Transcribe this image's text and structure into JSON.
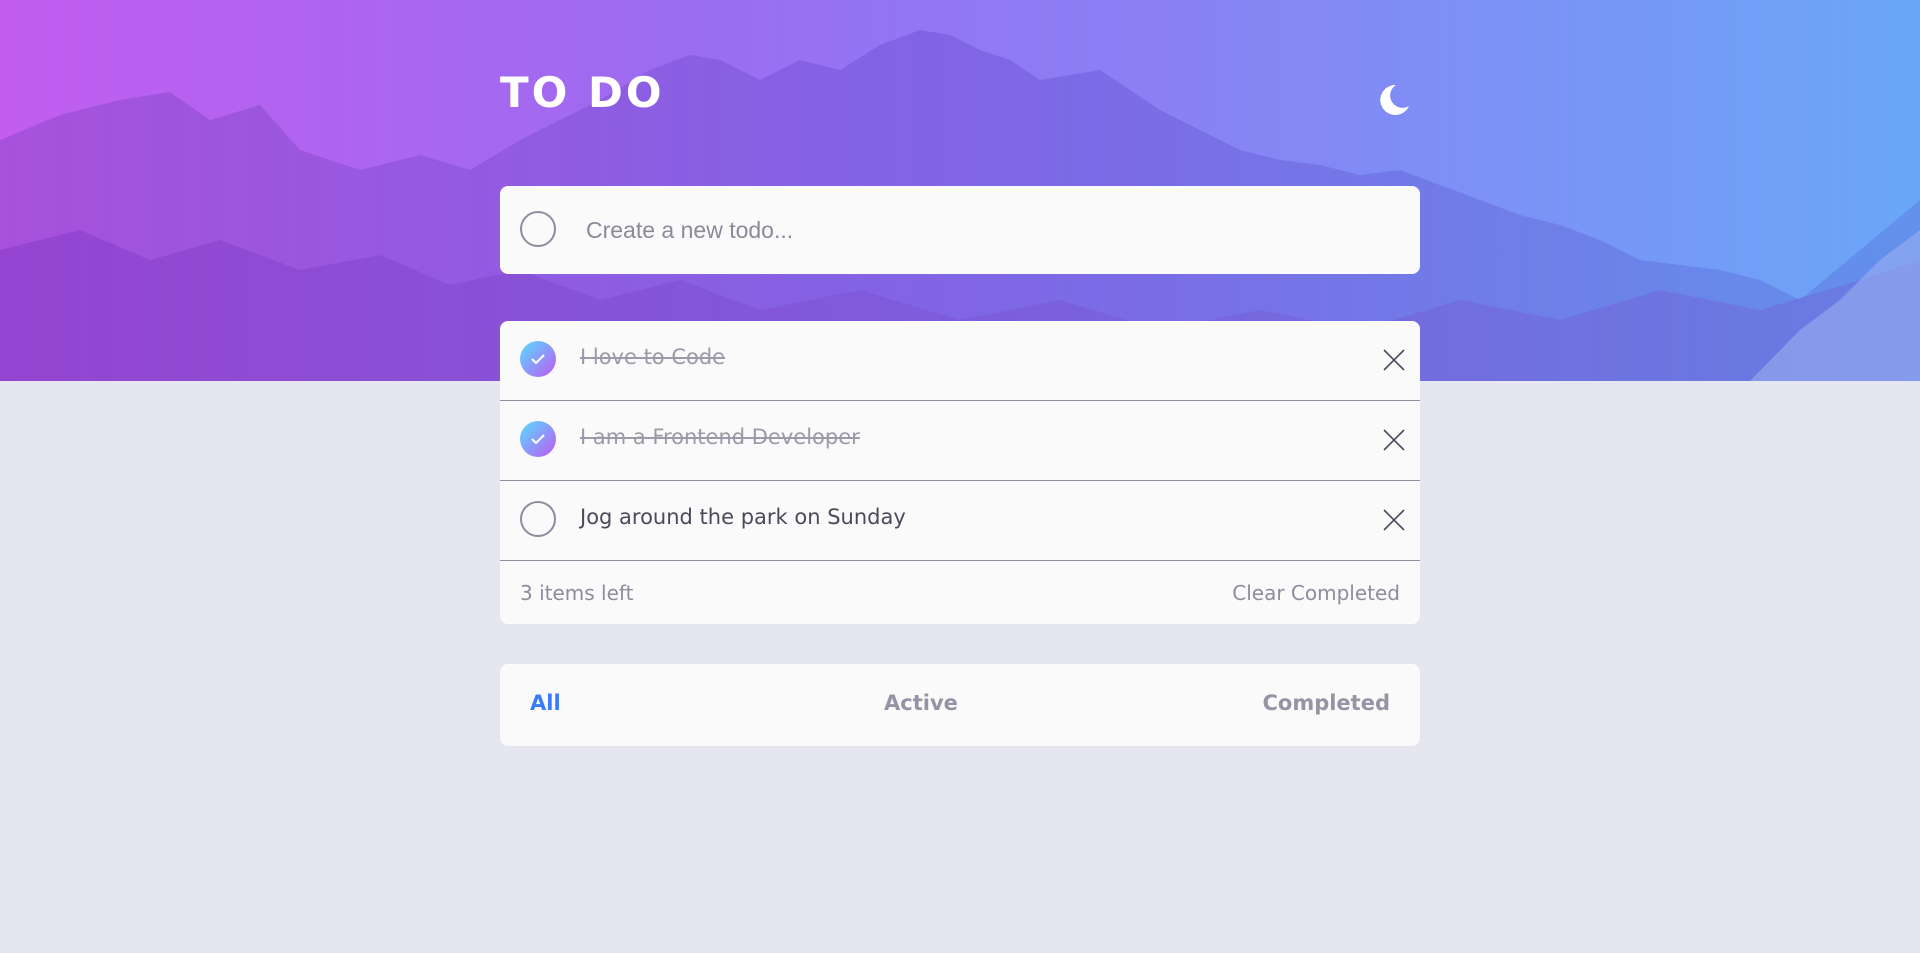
{
  "app": {
    "title": "TO DO"
  },
  "theme_toggle": {
    "icon": "moon-icon"
  },
  "new_todo": {
    "placeholder": "Create a new todo..."
  },
  "todos": [
    {
      "text": "I love to Code",
      "completed": true
    },
    {
      "text": "I am a Frontend Developer",
      "completed": true
    },
    {
      "text": "Jog around the park on Sunday",
      "completed": false
    }
  ],
  "footer": {
    "items_left": "3 items left",
    "clear_label": "Clear Completed"
  },
  "filters": {
    "all": "All",
    "active": "Active",
    "completed": "Completed",
    "selected": "all"
  },
  "colors": {
    "accent": "#3a7bfd",
    "check_gradient_start": "#55ddff",
    "check_gradient_end": "#c058f3",
    "background": "#e6e6f0"
  }
}
